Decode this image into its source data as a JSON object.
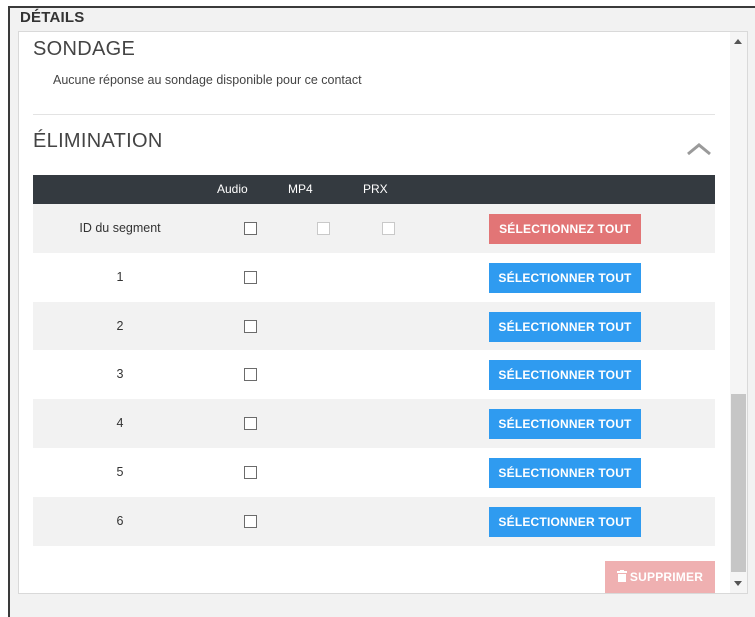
{
  "header": {
    "title": "DÉTAILS"
  },
  "survey": {
    "title": "SONDAGE",
    "message": "Aucune réponse au sondage disponible pour ce contact"
  },
  "elimination": {
    "title": "ÉLIMINATION",
    "collapse_icon": "chevron-up-icon",
    "columns": [
      "Audio",
      "MP4",
      "PRX"
    ],
    "header_row": {
      "label": "ID du segment",
      "button": "SÉLECTIONNEZ TOUT"
    },
    "rows": [
      {
        "id": "1",
        "button": "SÉLECTIONNER TOUT"
      },
      {
        "id": "2",
        "button": "SÉLECTIONNER TOUT"
      },
      {
        "id": "3",
        "button": "SÉLECTIONNER TOUT"
      },
      {
        "id": "4",
        "button": "SÉLECTIONNER TOUT"
      },
      {
        "id": "5",
        "button": "SÉLECTIONNER TOUT"
      },
      {
        "id": "6",
        "button": "SÉLECTIONNER TOUT"
      }
    ],
    "delete_button": {
      "label": "SUPPRIMER",
      "icon": "trash-icon"
    }
  },
  "colors": {
    "header_bg": "#343a40",
    "select_all_red": "#e27576",
    "select_all_blue": "#2f9bf0",
    "delete_disabled": "#efb0b1"
  }
}
